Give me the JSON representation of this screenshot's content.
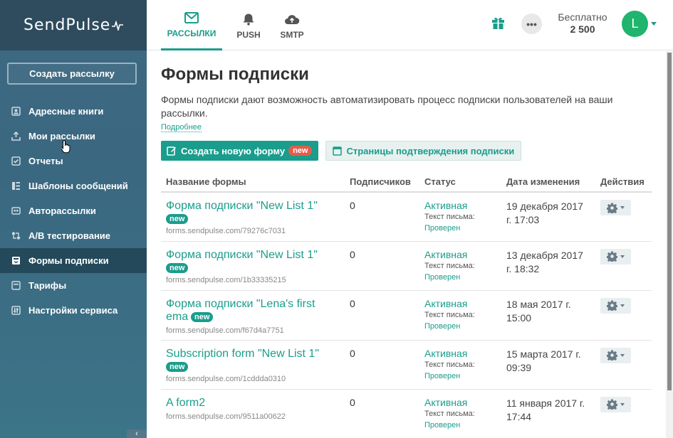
{
  "sidebar": {
    "logo": "SendPulse",
    "create_button": "Создать рассылку",
    "items": [
      {
        "label": "Адресные книги",
        "icon": "address-book-icon"
      },
      {
        "label": "Мои рассылки",
        "icon": "upload-icon"
      },
      {
        "label": "Отчеты",
        "icon": "checkbox-icon"
      },
      {
        "label": "Шаблоны сообщений",
        "icon": "templates-icon"
      },
      {
        "label": "Авторассылки",
        "icon": "autoresponder-icon"
      },
      {
        "label": "A/B тестирование",
        "icon": "ab-test-icon"
      },
      {
        "label": "Формы подписки",
        "icon": "form-icon",
        "active": true
      },
      {
        "label": "Тарифы",
        "icon": "pricing-icon"
      },
      {
        "label": "Настройки сервиса",
        "icon": "settings-icon"
      }
    ],
    "collapse_glyph": "‹"
  },
  "topbar": {
    "tabs": [
      {
        "label": "РАССЫЛКИ",
        "icon": "email-icon",
        "active": true
      },
      {
        "label": "PUSH",
        "icon": "bell-icon"
      },
      {
        "label": "SMTP",
        "icon": "cloud-upload-icon"
      }
    ],
    "more_glyph": "•••",
    "plan_name": "Бесплатно",
    "plan_count": "2 500",
    "avatar_letter": "L"
  },
  "page": {
    "title": "Формы подписки",
    "description": "Формы подписки дают возможность автоматизировать процесс подписки пользователей на ваши рассылки.",
    "more_link": "Подробнее",
    "create_form_button": "Создать новую форму",
    "new_badge": "new",
    "confirm_pages_button": "Страницы подтверждения подписки"
  },
  "table": {
    "headers": [
      "Название формы",
      "Подписчиков",
      "Статус",
      "Дата изменения",
      "Действия"
    ],
    "status_sub_label": "Текст письма:",
    "rows": [
      {
        "name": "Форма подписки \"New List 1\"",
        "is_new": true,
        "url": "forms.sendpulse.com/79276c7031",
        "subscribers": "0",
        "status": "Активная",
        "check": "Проверен",
        "date": "19 декабря 2017 г. 17:03"
      },
      {
        "name": "Форма подписки \"New List 1\"",
        "is_new": true,
        "url": "forms.sendpulse.com/1b33335215",
        "subscribers": "0",
        "status": "Активная",
        "check": "Проверен",
        "date": "13 декабря 2017 г. 18:32"
      },
      {
        "name": "Форма подписки \"Lena's first ema",
        "is_new": true,
        "url": "forms.sendpulse.com/f67d4a7751",
        "subscribers": "0",
        "status": "Активная",
        "check": "Проверен",
        "date": "18 мая 2017 г. 15:00"
      },
      {
        "name": "Subscription form \"New List 1\"",
        "is_new": true,
        "url": "forms.sendpulse.com/1cddda0310",
        "subscribers": "0",
        "status": "Активная",
        "check": "Проверен",
        "date": "15 марта 2017 г. 09:39"
      },
      {
        "name": "A form2",
        "is_new": false,
        "url": "forms.sendpulse.com/9511a00622",
        "subscribers": "0",
        "status": "Активная",
        "check": "Проверен",
        "date": "11 января 2017 г. 17:44"
      }
    ]
  },
  "colors": {
    "accent": "#1a9d8c",
    "sidebar": "#3a6880",
    "sidebar_dark": "#2f4c5e",
    "badge_red": "#e35d4b",
    "avatar": "#20b46e"
  }
}
